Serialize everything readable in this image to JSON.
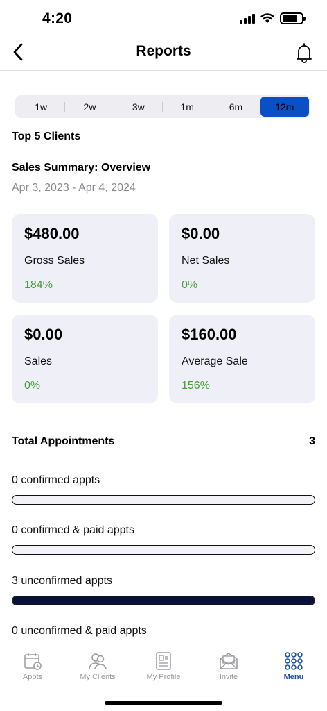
{
  "status": {
    "time": "4:20"
  },
  "nav": {
    "title": "Reports"
  },
  "periods": [
    {
      "label": "1w",
      "active": false
    },
    {
      "label": "2w",
      "active": false
    },
    {
      "label": "3w",
      "active": false
    },
    {
      "label": "1m",
      "active": false
    },
    {
      "label": "6m",
      "active": false
    },
    {
      "label": "12m",
      "active": true
    }
  ],
  "top_clients": {
    "heading": "Top 5 Clients"
  },
  "summary": {
    "heading": "Sales Summary: Overview",
    "date_range": "Apr 3, 2023 - Apr 4, 2024",
    "cards": [
      {
        "amount": "$480.00",
        "label": "Gross Sales",
        "change": "184%"
      },
      {
        "amount": "$0.00",
        "label": "Net Sales",
        "change": "0%"
      },
      {
        "amount": "$0.00",
        "label": "Sales",
        "change": "0%"
      },
      {
        "amount": "$160.00",
        "label": "Average Sale",
        "change": "156%"
      }
    ]
  },
  "appointments": {
    "heading": "Total Appointments",
    "total": "3",
    "items": [
      {
        "label": "0 confirmed appts",
        "fill": 0
      },
      {
        "label": "0 confirmed & paid appts",
        "fill": 0
      },
      {
        "label": "3 unconfirmed appts",
        "fill": 1
      },
      {
        "label": "0 unconfirmed & paid appts",
        "fill": 0
      }
    ]
  },
  "tabs": [
    {
      "label": "Appts",
      "icon": "calendar-icon",
      "active": false
    },
    {
      "label": "My Clients",
      "icon": "clients-icon",
      "active": false
    },
    {
      "label": "My Profile",
      "icon": "profile-icon",
      "active": false
    },
    {
      "label": "Invite",
      "icon": "invite-icon",
      "active": false
    },
    {
      "label": "Menu",
      "icon": "menu-dots-icon",
      "active": true
    }
  ],
  "colors": {
    "accent": "#0a50c4",
    "positive": "#4a9c3a",
    "bar_fill": "#0b1036",
    "card_bg": "#efeff7"
  }
}
